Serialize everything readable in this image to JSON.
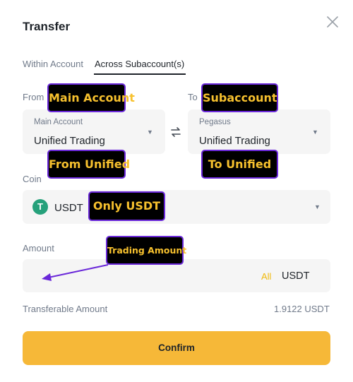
{
  "dialog": {
    "title": "Transfer"
  },
  "tabs": [
    {
      "label": "Within Account",
      "active": false
    },
    {
      "label": "Across Subaccount(s)",
      "active": true
    }
  ],
  "from": {
    "label": "From",
    "account_label": "Main Account",
    "account_value": "Unified Trading"
  },
  "to": {
    "label": "To",
    "account_label": "Pegasus",
    "account_value": "Unified Trading"
  },
  "coin": {
    "label": "Coin",
    "icon_glyph": "T",
    "value": "USDT",
    "icon_color": "#26a17b"
  },
  "amount": {
    "label": "Amount",
    "value": "",
    "all_label": "All",
    "unit": "USDT"
  },
  "transferable": {
    "label": "Transferable Amount",
    "value": "1.9122 USDT"
  },
  "confirm_label": "Confirm",
  "annotations": {
    "main_account": "Main Account",
    "subaccount": "Subaccount",
    "from_unified": "From Unified",
    "to_unified": "To Unified",
    "only_usdt": "Only USDT",
    "trading_amount": "Trading Amount"
  },
  "colors": {
    "accent": "#f6b838",
    "all_link": "#f0b90b",
    "annotation_border": "#6a28d9",
    "annotation_text": "#f7c12e"
  }
}
